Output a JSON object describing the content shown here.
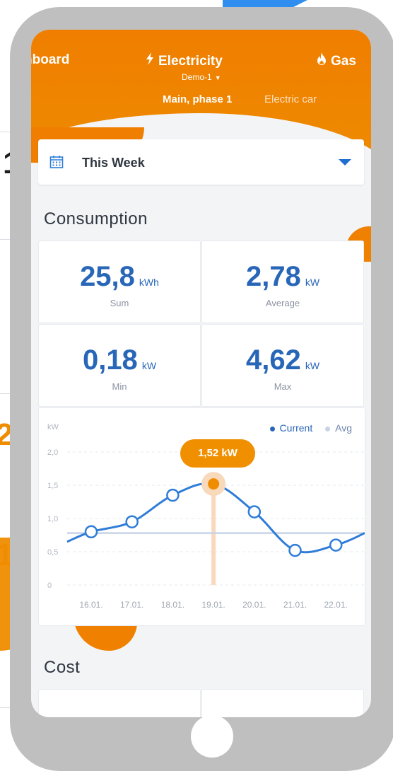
{
  "tabs": [
    {
      "label": "hboard"
    },
    {
      "label": "Electricity",
      "icon": "bolt-icon"
    },
    {
      "label": "Gas",
      "icon": "flame-icon"
    }
  ],
  "device": {
    "label": "Demo-1"
  },
  "subtabs": [
    {
      "label": "Main, phase 1"
    },
    {
      "label": "Electric car"
    }
  ],
  "period": {
    "label": "This Week"
  },
  "consumption": {
    "title": "Consumption",
    "stats": [
      {
        "value": "25,8",
        "unit": "kWh",
        "caption": "Sum"
      },
      {
        "value": "2,78",
        "unit": "kW",
        "caption": "Average"
      },
      {
        "value": "0,18",
        "unit": "kW",
        "caption": "Min"
      },
      {
        "value": "4,62",
        "unit": "kW",
        "caption": "Max"
      }
    ]
  },
  "cost": {
    "title": "Cost"
  },
  "background": {
    "glyph_a": "1",
    "glyph_b": "2",
    "glyph_c": "1"
  },
  "colors": {
    "accent": "#f08c00",
    "primary": "#2866b8",
    "screen_bg": "#f3f4f6"
  },
  "chart_data": {
    "type": "line",
    "ylabel": "kW",
    "ylim": [
      0,
      2.0
    ],
    "yticks": [
      "0",
      "0,5",
      "1,0",
      "1,5",
      "2,0"
    ],
    "ytick_values": [
      0,
      0.5,
      1.0,
      1.5,
      2.0
    ],
    "categories": [
      "16.01.",
      "17.01.",
      "18.01.",
      "19.01.",
      "20.01.",
      "21.01.",
      "22.01."
    ],
    "series": [
      {
        "name": "Current",
        "values": [
          0.8,
          0.95,
          1.35,
          1.52,
          1.1,
          0.52,
          0.6
        ]
      },
      {
        "name": "Avg",
        "values": [
          0.78,
          0.78,
          0.78,
          0.78,
          0.78,
          0.78,
          0.78
        ]
      }
    ],
    "highlight": {
      "index": 3,
      "label": "1,52 kW"
    },
    "grid": true,
    "legend": "top-right"
  }
}
